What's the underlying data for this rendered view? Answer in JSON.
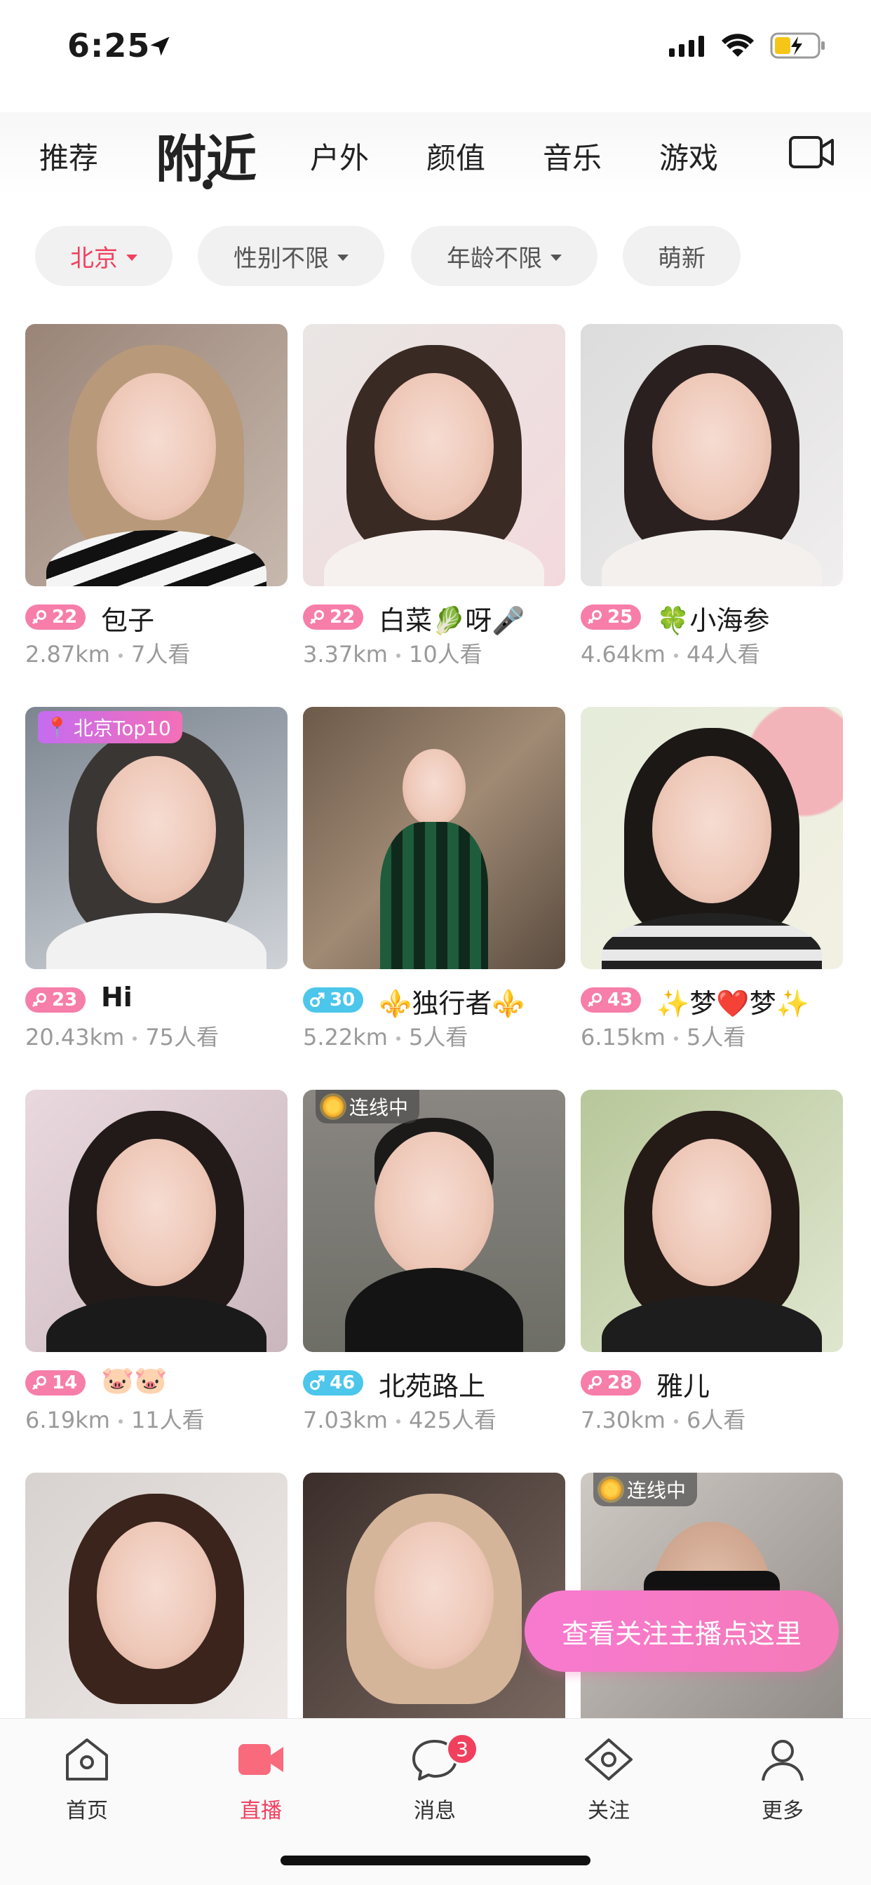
{
  "status_bar": {
    "time": "6:25"
  },
  "tabs": {
    "items": [
      "推荐",
      "附近",
      "户外",
      "颜值",
      "音乐",
      "游戏"
    ],
    "active": "附近"
  },
  "filters": {
    "location": "北京",
    "gender": "性别不限",
    "age": "年龄不限",
    "newbie": "萌新"
  },
  "cards": [
    {
      "gender": "f",
      "age": "22",
      "name": "包子",
      "distance": "2.87km",
      "viewers": "7人看",
      "tag": ""
    },
    {
      "gender": "f",
      "age": "22",
      "name": "白菜🥬呀🎤",
      "distance": "3.37km",
      "viewers": "10人看",
      "tag": ""
    },
    {
      "gender": "f",
      "age": "25",
      "name": "🍀小海参",
      "distance": "4.64km",
      "viewers": "44人看",
      "tag": ""
    },
    {
      "gender": "f",
      "age": "23",
      "name": "Hi",
      "distance": "20.43km",
      "viewers": "75人看",
      "tag": "北京Top10"
    },
    {
      "gender": "m",
      "age": "30",
      "name": "⚜️独行者⚜️",
      "distance": "5.22km",
      "viewers": "5人看",
      "tag": ""
    },
    {
      "gender": "f",
      "age": "43",
      "name": "✨梦❤️梦✨",
      "distance": "6.15km",
      "viewers": "5人看",
      "tag": ""
    },
    {
      "gender": "f",
      "age": "14",
      "name": "🐷🐷",
      "distance": "6.19km",
      "viewers": "11人看",
      "tag": ""
    },
    {
      "gender": "m",
      "age": "46",
      "name": "北苑路上",
      "distance": "7.03km",
      "viewers": "425人看",
      "tag": "连线中"
    },
    {
      "gender": "f",
      "age": "28",
      "name": "雅儿",
      "distance": "7.30km",
      "viewers": "6人看",
      "tag": ""
    },
    {
      "gender": "f",
      "age": "",
      "name": "",
      "distance": "",
      "viewers": "",
      "tag": ""
    },
    {
      "gender": "f",
      "age": "",
      "name": "",
      "distance": "",
      "viewers": "",
      "tag": ""
    },
    {
      "gender": "f",
      "age": "",
      "name": "",
      "distance": "",
      "viewers": "",
      "tag": "连线中"
    }
  ],
  "cta": {
    "label": "查看关注主播点这里"
  },
  "bottom_nav": {
    "items": [
      "首页",
      "直播",
      "消息",
      "关注",
      "更多"
    ],
    "active": "直播",
    "message_badge": "3"
  },
  "colors": {
    "accent": "#f0405e",
    "female_badge": "#f67ea8",
    "male_badge": "#4cc6ea"
  }
}
